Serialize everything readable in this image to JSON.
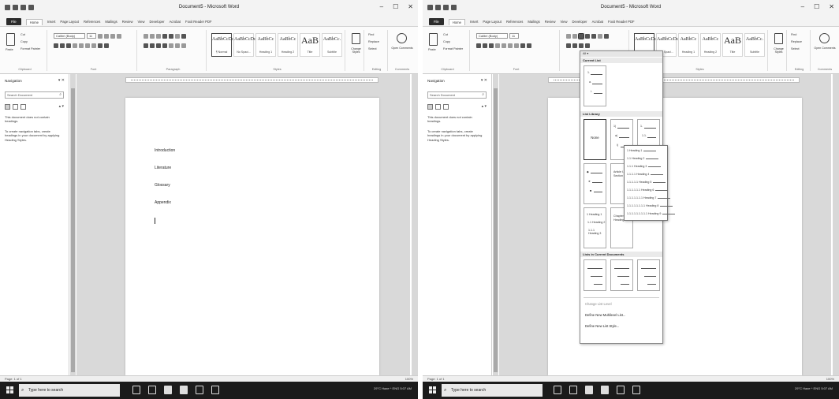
{
  "window": {
    "title": "Document5 - Microsoft Word",
    "minimize": "–",
    "restore": "☐",
    "close": "✕"
  },
  "ribbon": {
    "tabs": [
      "File",
      "Home",
      "Insert",
      "Page Layout",
      "References",
      "Mailings",
      "Review",
      "View",
      "Developer",
      "Acrobat",
      "Foxit Reader PDF"
    ],
    "active_tab": "Home",
    "groups": {
      "clipboard": "Clipboard",
      "font": "Font",
      "paragraph": "Paragraph",
      "styles": "Styles",
      "editing": "Editing",
      "comments": "Comments"
    },
    "clipboard": {
      "paste": "Paste",
      "cut": "Cut",
      "copy": "Copy",
      "format_painter": "Format Painter"
    },
    "font": {
      "name": "Calibri (Body)",
      "size": "11"
    },
    "styles": [
      {
        "sample": "AaBbCcDc",
        "name": "¶ Normal"
      },
      {
        "sample": "AaBbCcDc",
        "name": "No Spaci..."
      },
      {
        "sample": "AaBbCc",
        "name": "Heading 1"
      },
      {
        "sample": "AaBbCc",
        "name": "Heading 2"
      },
      {
        "sample": "AaB",
        "name": "Title"
      },
      {
        "sample": "AaBbCc.",
        "name": "Subtitle"
      }
    ],
    "change_styles": "Change Styles",
    "find": "Find",
    "replace": "Replace",
    "select": "Select",
    "open_comments": "Open Comments"
  },
  "navigation": {
    "title": "Navigation",
    "search_placeholder": "Search Document",
    "message1": "This document does not contain headings.",
    "message2": "To create navigation tabs, create headings in your document by applying Heading Styles."
  },
  "document": {
    "lines": [
      "Introduction",
      "Literature",
      "Glossary",
      "Appendix"
    ]
  },
  "statusbar": {
    "left": "Page: 1 of 1",
    "right": "100%"
  },
  "taskbar": {
    "search_placeholder": "Type here to search",
    "tray": "29°C Haze  ^  ENG  5:07 AM"
  },
  "multilevel": {
    "current_list": "Current List",
    "list_library": "List Library",
    "none_label": "None",
    "lists_in_documents": "Lists in Current Documents",
    "change_level": "Change List Level",
    "define_new_multilevel": "Define New Multilevel List...",
    "define_new_style": "Define New List Style...",
    "article_label": "Article I. Section 1.01",
    "chapter_label": "Chapter 1 Heading",
    "heading_items": [
      "1 Heading 1",
      "1.1 Heading 2",
      "1.1.1 Heading 3"
    ],
    "preview_lines": [
      "1 Heading 1",
      "1.1 Heading 2",
      "1.1.1 Heading 3",
      "1.1.1.1 Heading 4",
      "1.1.1.1.1 Heading 5",
      "1.1.1.1.1.1 Heading 6",
      "1.1.1.1.1.1.1 Heading 7",
      "1.1.1.1.1.1.1.1 Heading 8",
      "1.1.1.1.1.1.1.1.1 Heading 9"
    ]
  }
}
